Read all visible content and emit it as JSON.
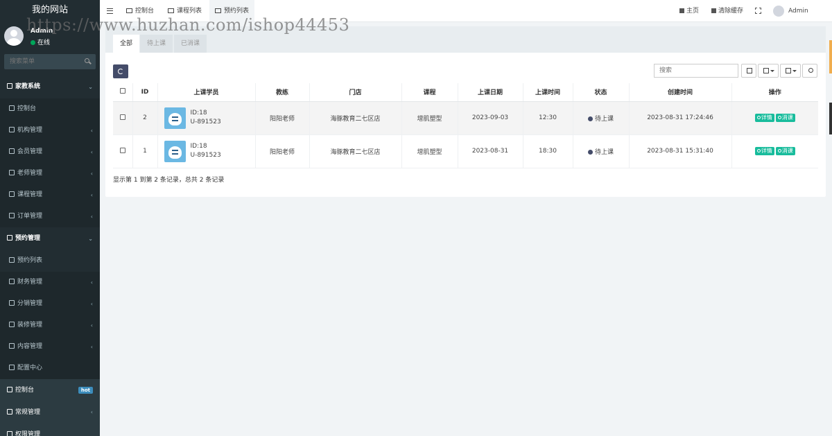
{
  "sidebar": {
    "logo": "我的网站",
    "user": {
      "name": "Admin",
      "status": "在线"
    },
    "search_placeholder": "搜索菜单",
    "menu": [
      {
        "label": "家教系统",
        "arrow": "⌄",
        "icon": "settings-icon",
        "type": "head"
      },
      {
        "label": "控制台",
        "arrow": "",
        "icon": "dashboard-icon",
        "type": "sub"
      },
      {
        "label": "机构管理",
        "arrow": "‹",
        "icon": "building-icon",
        "type": "sub"
      },
      {
        "label": "会员管理",
        "arrow": "‹",
        "icon": "user-icon",
        "type": "sub"
      },
      {
        "label": "老师管理",
        "arrow": "‹",
        "icon": "teacher-icon",
        "type": "sub"
      },
      {
        "label": "课程管理",
        "arrow": "‹",
        "icon": "book-icon",
        "type": "sub"
      },
      {
        "label": "订单管理",
        "arrow": "‹",
        "icon": "order-icon",
        "type": "sub"
      },
      {
        "label": "预约管理",
        "arrow": "⌄",
        "icon": "cube-icon",
        "type": "head"
      },
      {
        "label": "预约列表",
        "arrow": "",
        "icon": "list-icon",
        "type": "active"
      },
      {
        "label": "财务管理",
        "arrow": "‹",
        "icon": "diamond-icon",
        "type": "sub"
      },
      {
        "label": "分销管理",
        "arrow": "‹",
        "icon": "users-icon",
        "type": "sub"
      },
      {
        "label": "装修管理",
        "arrow": "‹",
        "icon": "image-icon",
        "type": "sub"
      },
      {
        "label": "内容管理",
        "arrow": "‹",
        "icon": "edit-icon",
        "type": "sub"
      },
      {
        "label": "配置中心",
        "arrow": "",
        "icon": "gear-icon",
        "type": "sub"
      },
      {
        "label": "控制台",
        "badge": "hot",
        "icon": "dashboard-icon",
        "type": "bottom"
      },
      {
        "label": "常规管理",
        "arrow": "‹",
        "icon": "cogs-icon",
        "type": "bottom"
      },
      {
        "label": "权限管理",
        "arrow": "",
        "icon": "key-icon",
        "type": "bottom"
      }
    ]
  },
  "topbar": {
    "tabs": [
      "控制台",
      "课程列表",
      "预约列表"
    ],
    "home": "主页",
    "clear_cache": "清除缓存",
    "admin": "Admin"
  },
  "panel": {
    "tabs": [
      "全部",
      "待上课",
      "已消课"
    ],
    "search_placeholder": "搜索",
    "columns": [
      "ID",
      "上课学员",
      "教练",
      "门店",
      "课程",
      "上课日期",
      "上课时间",
      "状态",
      "创建时间",
      "操作"
    ],
    "rows": [
      {
        "id": "2",
        "student_id": "ID:18",
        "student_code": "U-891523",
        "coach": "阳阳老师",
        "store": "海豚教育二七区店",
        "course": "增肌塑型",
        "date": "2023-09-03",
        "time": "12:30",
        "status": "待上课",
        "created": "2023-08-31 17:24:46"
      },
      {
        "id": "1",
        "student_id": "ID:18",
        "student_code": "U-891523",
        "coach": "阳阳老师",
        "store": "海豚教育二七区店",
        "course": "增肌塑型",
        "date": "2023-08-31",
        "time": "18:30",
        "status": "待上课",
        "created": "2023-08-31 15:31:40"
      }
    ],
    "actions": {
      "detail": "详情",
      "consume": "消课"
    },
    "pager_text": "显示第 1 到第 2 条记录，总共 2 条记录"
  },
  "watermark": "https://www.huzhan.com/ishop44453"
}
